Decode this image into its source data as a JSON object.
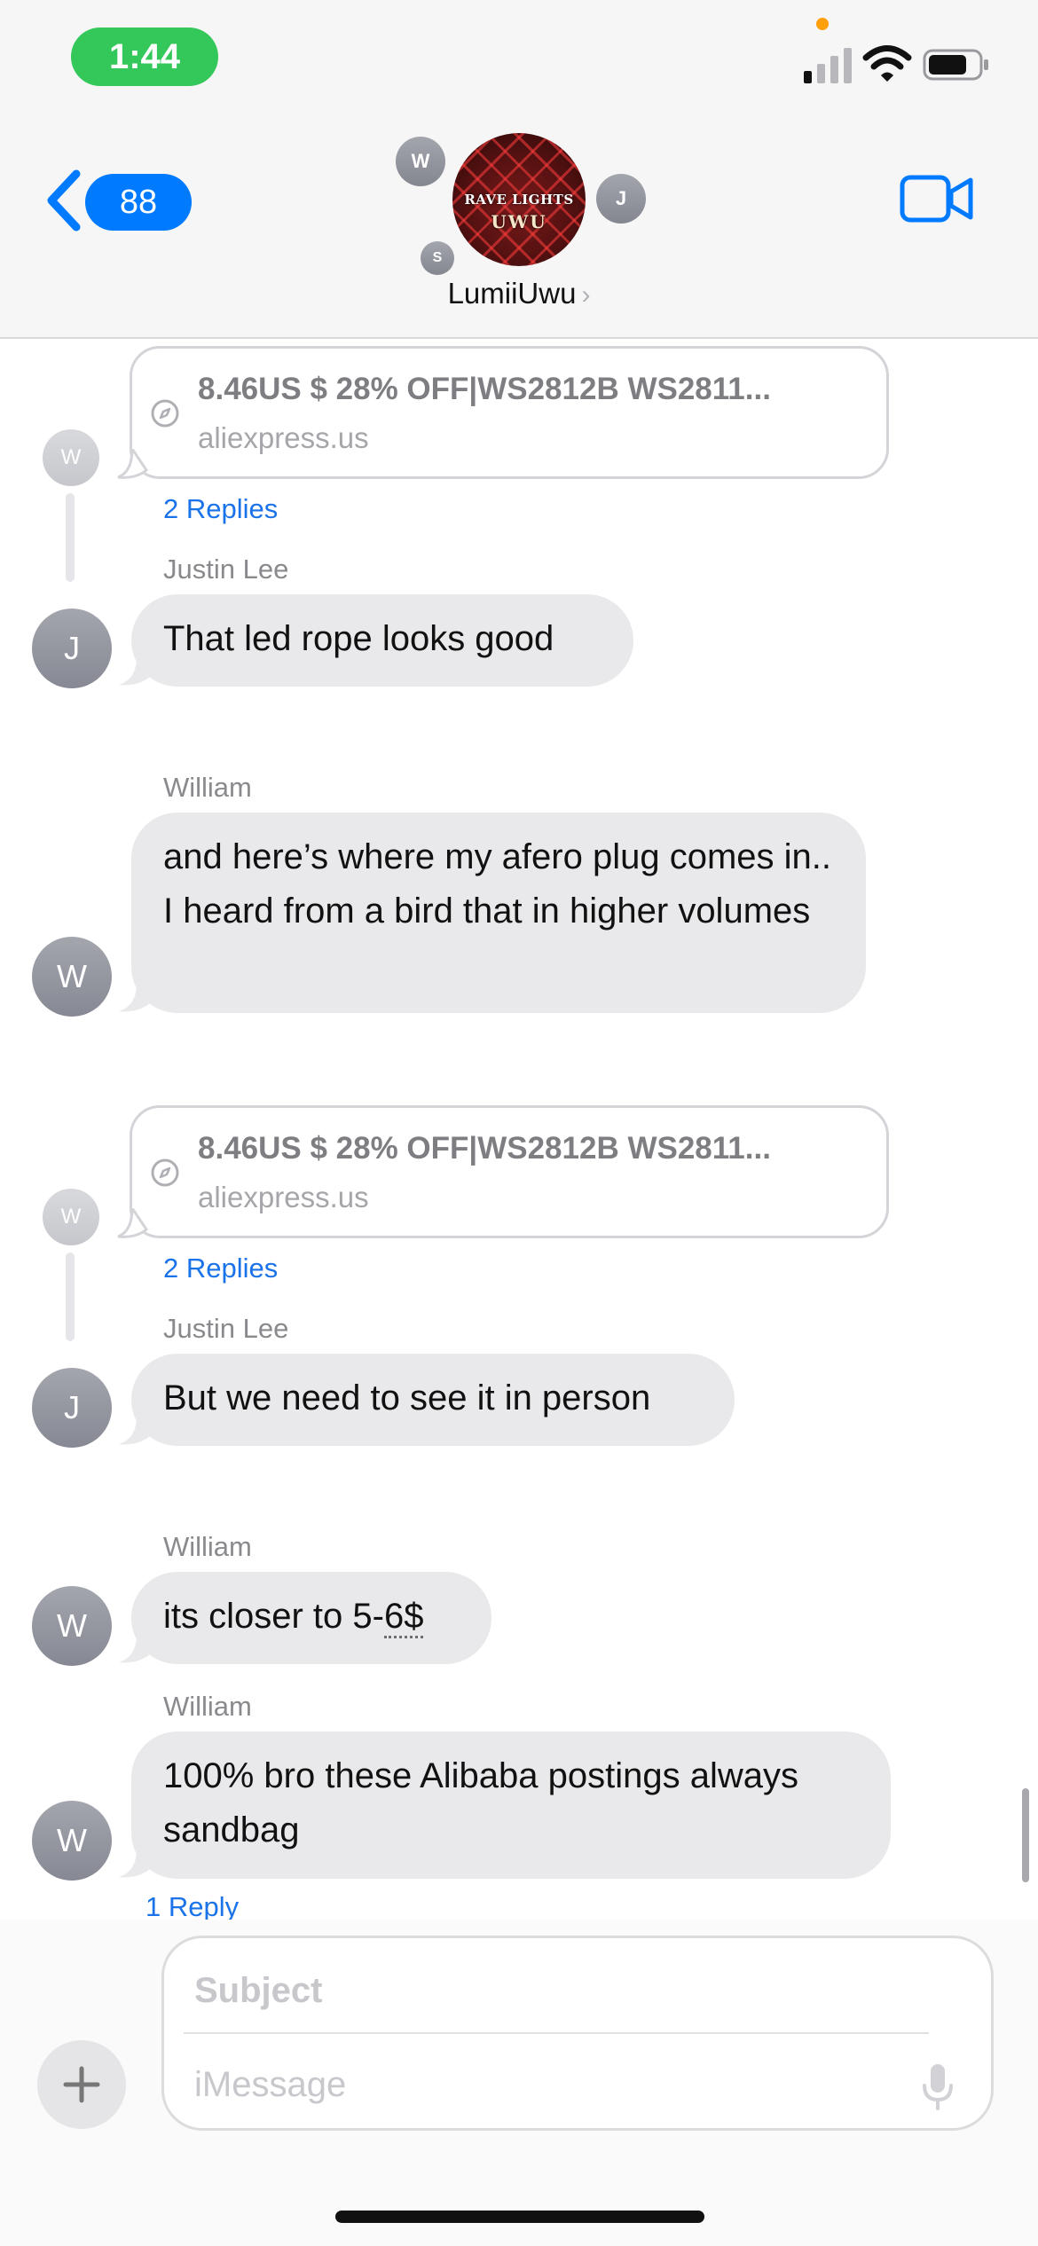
{
  "status_bar": {
    "time": "1:44"
  },
  "header": {
    "back_badge": "88",
    "group_photo_text_top": "RAVE LIGHTS",
    "group_photo_text_bottom": "UWU",
    "participant_initials": [
      "W",
      "J",
      "S"
    ],
    "title": "LumiiUwu",
    "title_chevron": "›"
  },
  "messages": [
    {
      "type": "link",
      "avatar": "W",
      "title": "8.46US $ 28% OFF|WS2812B WS2811...",
      "domain": "aliexpress.us",
      "replies": "2 Replies"
    },
    {
      "type": "text",
      "sender": "Justin Lee",
      "avatar": "J",
      "text": "That led rope looks good"
    },
    {
      "type": "text",
      "sender": "William",
      "avatar": "W",
      "text": "and here’s where my afero plug comes in.. I heard from a bird that in higher volumes"
    },
    {
      "type": "link",
      "avatar": "W",
      "title": "8.46US $ 28% OFF|WS2812B WS2811...",
      "domain": "aliexpress.us",
      "replies": "2 Replies"
    },
    {
      "type": "text",
      "sender": "Justin Lee",
      "avatar": "J",
      "text": "But we need to see it in person"
    },
    {
      "type": "text",
      "sender": "William",
      "avatar": "W",
      "text_before": "its closer to 5-",
      "text_detected": "6$"
    },
    {
      "type": "text",
      "sender": "William",
      "avatar": "W",
      "text": "100% bro these Alibaba postings always sandbag",
      "replies": "1 Reply"
    }
  ],
  "composer": {
    "subject_placeholder": "Subject",
    "message_placeholder": "iMessage"
  },
  "colors": {
    "accent": "#007aff",
    "status_time_bg": "#34c759",
    "bubble_received": "#e9e9eb",
    "reply_link": "#1a73e8"
  },
  "icons": [
    "back-chevron-icon",
    "video-camera-icon",
    "signal-icon",
    "wifi-icon",
    "battery-icon",
    "compass-icon",
    "plus-icon",
    "microphone-icon"
  ]
}
